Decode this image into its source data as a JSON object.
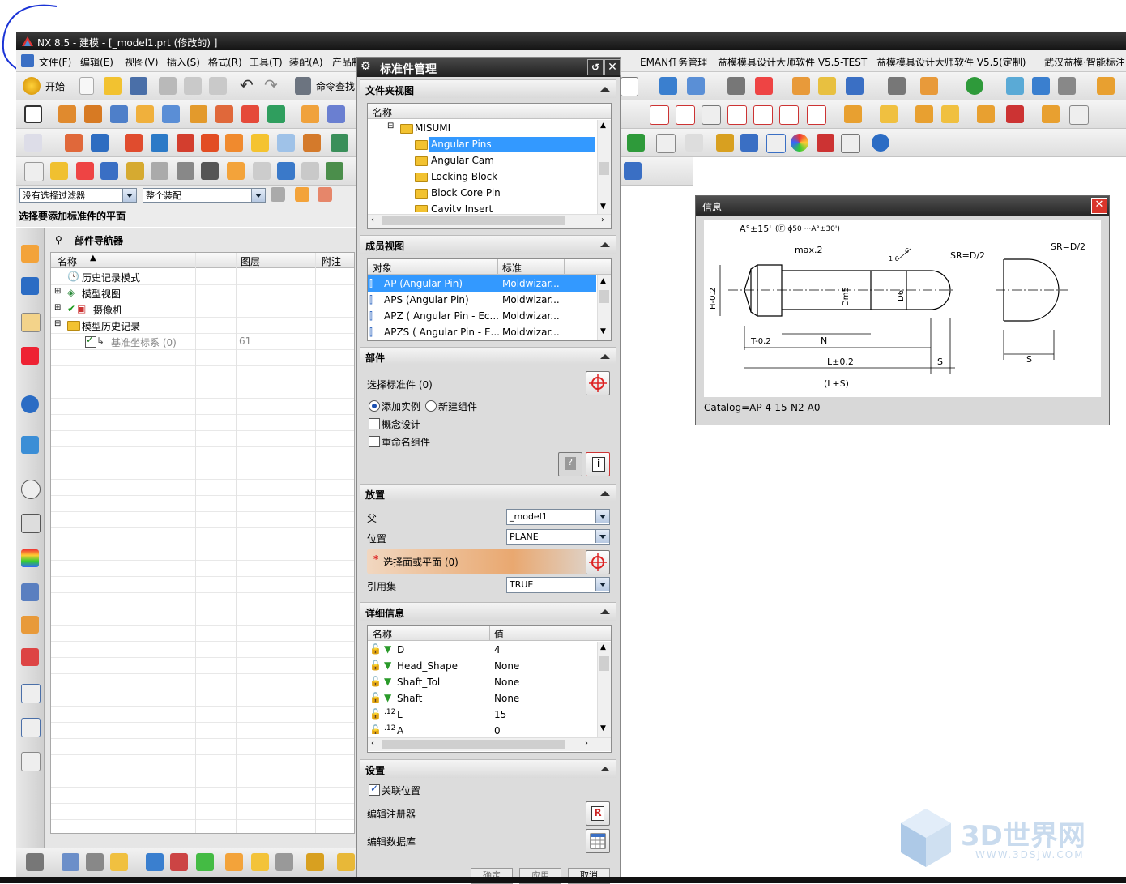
{
  "app": {
    "title": "NX 8.5 - 建模 - [_model1.prt  (修改的) ]"
  },
  "menu": [
    "文件(F)",
    "编辑(E)",
    "视图(V)",
    "插入(S)",
    "格式(R)",
    "工具(T)",
    "装配(A)",
    "产品制造...",
    "EMAN任务管理",
    "益模模具设计大师软件 V5.5-TEST",
    "益模模具设计大师软件 V5.5(定制)",
    "武汉益模·智能标注"
  ],
  "toolbar": {
    "start_label": "开始",
    "command_finder_label": "命令查找"
  },
  "filter": {
    "selection_filter": "没有选择过滤器",
    "scope": "整个装配"
  },
  "cue": "选择要添加标准件的平面",
  "navigator": {
    "title": "部件导航器",
    "columns": [
      "名称",
      "图层",
      "附注"
    ],
    "rows": [
      {
        "label": "历史记录模式",
        "layer": ""
      },
      {
        "label": "模型视图",
        "layer": ""
      },
      {
        "label": "摄像机",
        "layer": ""
      },
      {
        "label": "模型历史记录",
        "layer": ""
      },
      {
        "label": "基准坐标系 (0)",
        "layer": "61"
      }
    ]
  },
  "dialog": {
    "title": "标准件管理",
    "folder_view": {
      "heading": "文件夹视图",
      "column": "名称",
      "items": [
        "MISUMI",
        "Angular Pins",
        "Angular Cam",
        "Locking Block",
        "Block Core Pin",
        "Cavity Insert"
      ],
      "selected": "Angular Pins"
    },
    "member_view": {
      "heading": "成员视图",
      "columns": [
        "对象",
        "标准"
      ],
      "rows": [
        {
          "object": "AP (Angular Pin)",
          "standard": "Moldwizar..."
        },
        {
          "object": "APS (Angular Pin)",
          "standard": "Moldwizar..."
        },
        {
          "object": "APZ ( Angular Pin - Ec...",
          "standard": "Moldwizar..."
        },
        {
          "object": "APZS ( Angular Pin - E...",
          "standard": "Moldwizar..."
        }
      ]
    },
    "part": {
      "heading": "部件",
      "select_label": "选择标准件 (0)",
      "radio_add": "添加实例",
      "radio_new": "新建组件",
      "concept_design": "概念设计",
      "rename_component": "重命名组件"
    },
    "placement": {
      "heading": "放置",
      "parent_label": "父",
      "parent_value": "_model1",
      "position_label": "位置",
      "position_value": "PLANE",
      "select_face": "选择面或平面 (0)",
      "refset_label": "引用集",
      "refset_value": "TRUE"
    },
    "details": {
      "heading": "详细信息",
      "columns": [
        "名称",
        "值"
      ],
      "rows": [
        {
          "name": "D",
          "value": "4"
        },
        {
          "name": "Head_Shape",
          "value": "None"
        },
        {
          "name": "Shaft_Tol",
          "value": "None"
        },
        {
          "name": "Shaft",
          "value": "None"
        },
        {
          "name": "L",
          "value": "15"
        },
        {
          "name": "A",
          "value": "0"
        }
      ]
    },
    "settings": {
      "heading": "设置",
      "associative_position": "关联位置",
      "edit_registry": "编辑注册器",
      "edit_database": "编辑数据库"
    },
    "buttons": {
      "ok": "确定",
      "apply": "应用",
      "cancel": "取消"
    }
  },
  "info_window": {
    "title": "信息",
    "catalog": "Catalog=AP 4-15-N2-A0",
    "labels": {
      "angle": "A°±15'",
      "angle2": "(Ⓟ ϕ50 ···A°±30')",
      "max2": "max.2",
      "sr1": "SR=D/2",
      "sr2": "SR=D/2",
      "h": "H-0.2",
      "dm5": "Dm5",
      "d6": "D6",
      "t": "T-0.2",
      "n": "N",
      "l": "L±0.2",
      "s1": "S",
      "s2": "S",
      "ls": "(L+S)",
      "six": "6",
      "onesix": "1.6"
    }
  },
  "watermark": {
    "brand": "3D世界网",
    "url": "WWW.3DSJW.COM"
  }
}
